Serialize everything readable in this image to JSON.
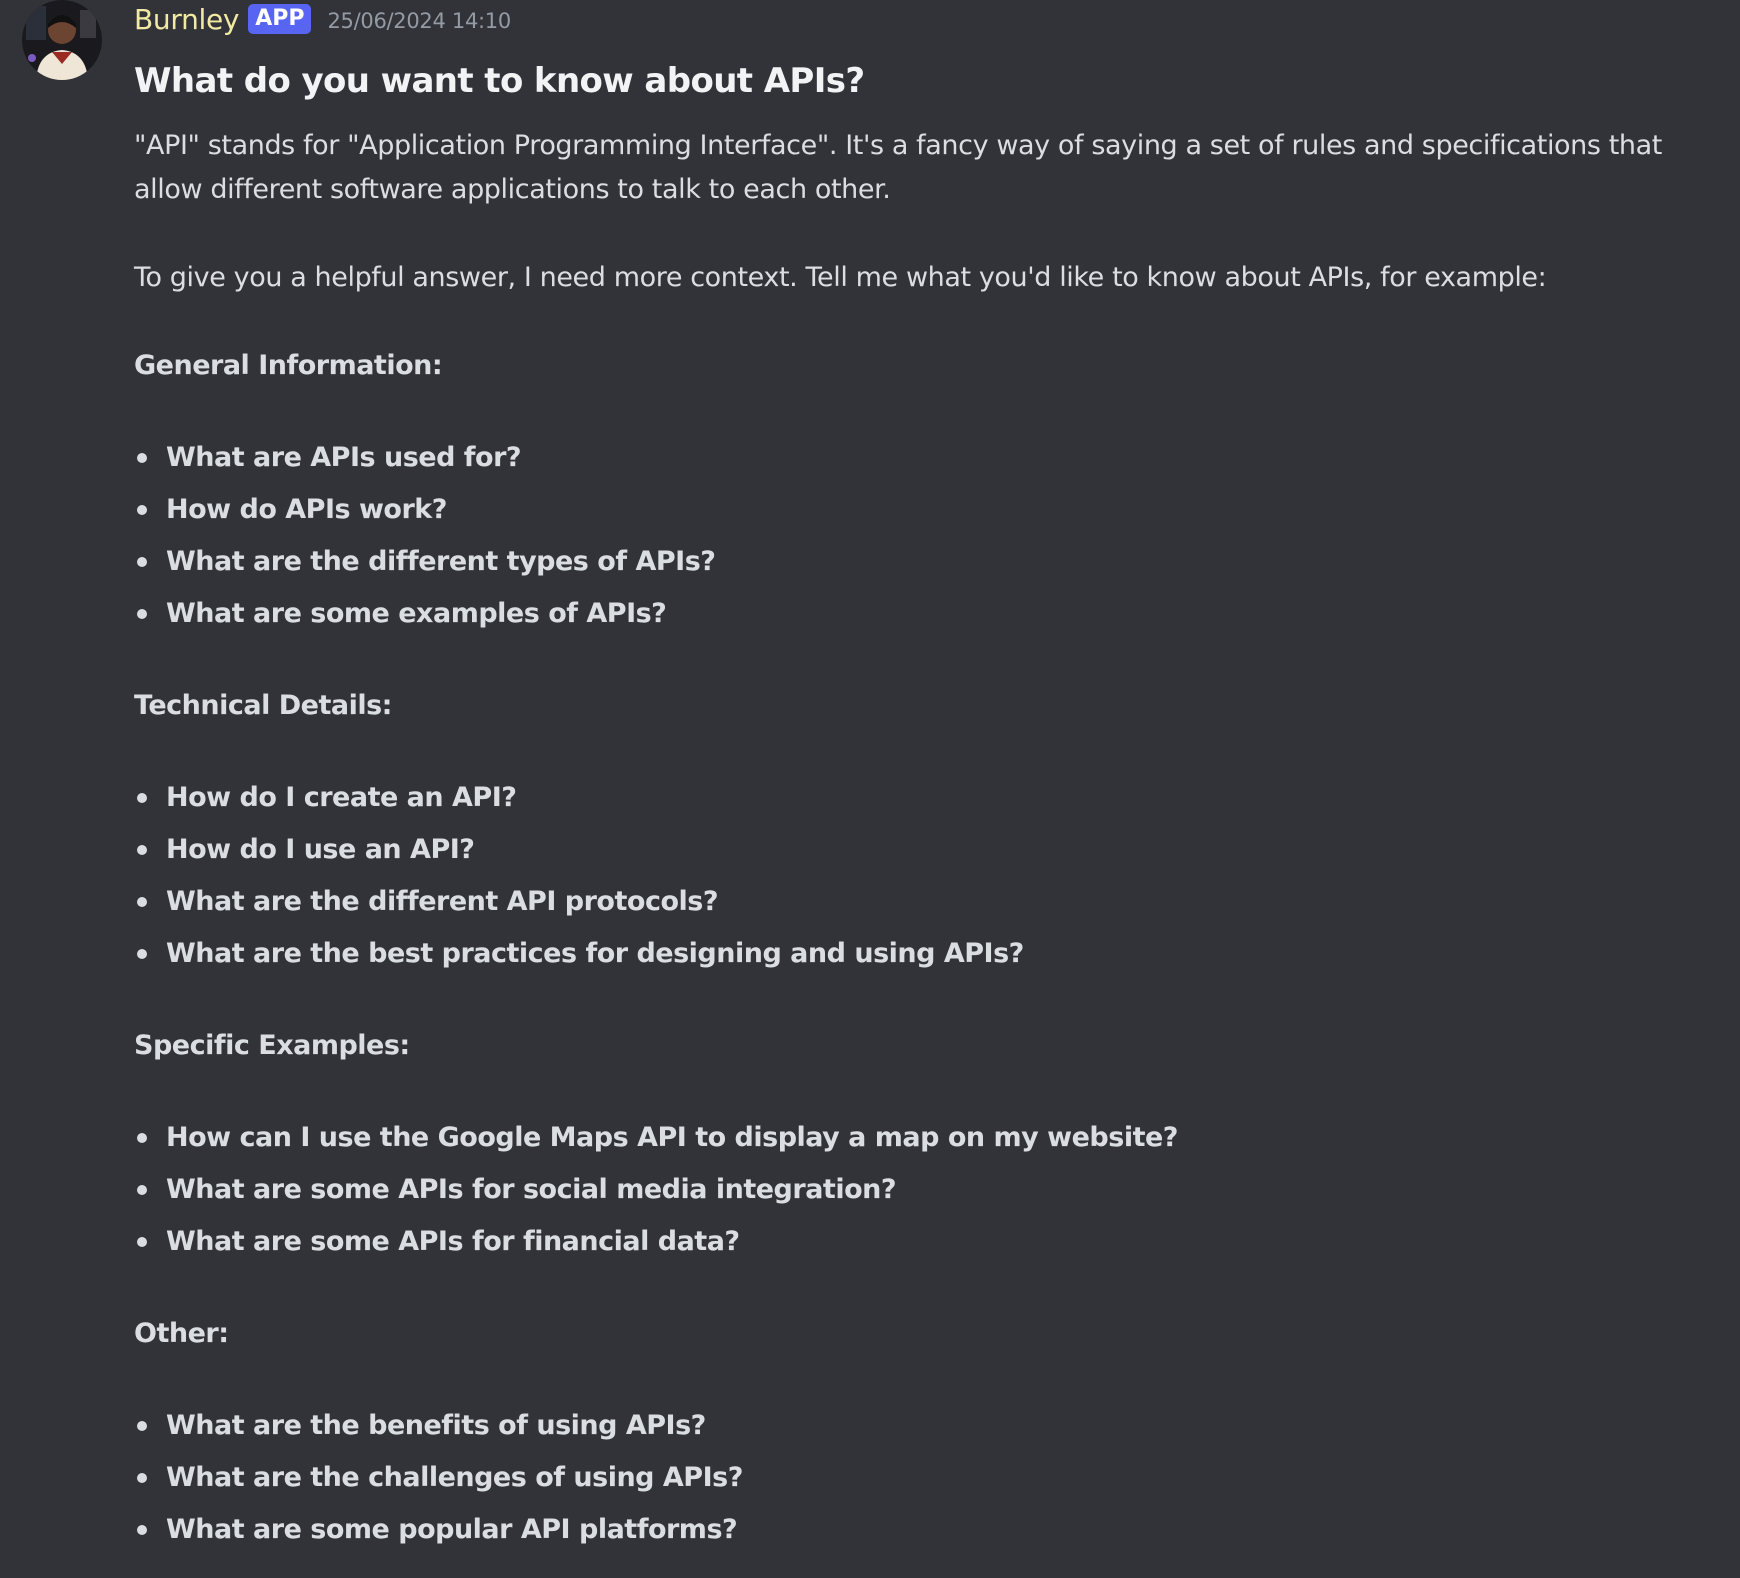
{
  "message": {
    "author": "Burnley",
    "badge": "APP",
    "timestamp": "25/06/2024 14:10",
    "title": "What do you want to know about APIs?",
    "paragraphs": [
      "\"API\" stands for \"Application Programming Interface\". It's a fancy way of saying a set of rules and specifications that allow different software applications to talk to each other.",
      "To give you a helpful answer, I need more context. Tell me what you'd like to know about APIs, for example:"
    ],
    "sections": [
      {
        "heading": "General Information:",
        "items": [
          "What are APIs used for?",
          "How do APIs work?",
          "What are the different types of APIs?",
          "What are some examples of APIs?"
        ]
      },
      {
        "heading": "Technical Details:",
        "items": [
          "How do I create an API?",
          "How do I use an API?",
          "What are the different API protocols?",
          "What are the best practices for designing and using APIs?"
        ]
      },
      {
        "heading": "Specific Examples:",
        "items": [
          "How can I use the Google Maps API to display a map on my website?",
          "What are some APIs for social media integration?",
          "What are some APIs for financial data?"
        ]
      },
      {
        "heading": "Other:",
        "items": [
          "What are the benefits of using APIs?",
          "What are the challenges of using APIs?",
          "What are some popular API platforms?"
        ]
      }
    ]
  },
  "colors": {
    "background": "#313338",
    "author": "#f1e9a4",
    "badge": "#5865f2",
    "text": "#dbdee1",
    "timestamp": "#949ba4"
  }
}
